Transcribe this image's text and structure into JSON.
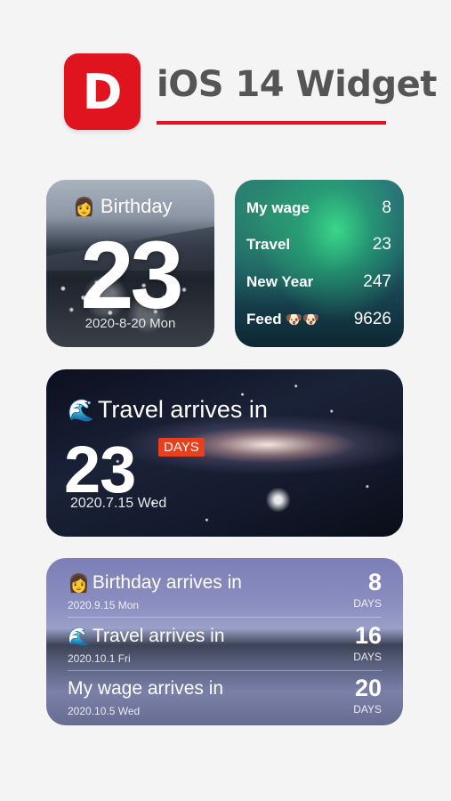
{
  "header": {
    "icon_letter": "D",
    "title": "iOS 14 Widget"
  },
  "widgets": {
    "birthday_small": {
      "emoji": "👩",
      "title": "Birthday",
      "count": "23",
      "date": "2020-8-20 Mon"
    },
    "aurora_list": {
      "rows": [
        {
          "label": "My wage",
          "value": "8"
        },
        {
          "label": "Travel",
          "value": "23"
        },
        {
          "label": "New Year",
          "value": "247"
        },
        {
          "label": "Feed",
          "emoji": "🐶🐶",
          "value": "9626"
        }
      ]
    },
    "travel_medium": {
      "emoji": "🌊",
      "title": "Travel arrives in",
      "count": "23",
      "badge": "DAYS",
      "date": "2020.7.15 Wed"
    },
    "lake_list": {
      "items": [
        {
          "emoji": "👩",
          "title": "Birthday arrives in",
          "date": "2020.9.15 Mon",
          "count": "8",
          "unit": "DAYS"
        },
        {
          "emoji": "🌊",
          "title": "Travel arrives in",
          "date": "2020.10.1 Fri",
          "count": "16",
          "unit": "DAYS"
        },
        {
          "emoji": "",
          "title": "My wage arrives in",
          "date": "2020.10.5 Wed",
          "count": "20",
          "unit": "DAYS"
        }
      ]
    }
  },
  "colors": {
    "brand_red": "#e0141e",
    "badge_orange": "#e8401e"
  }
}
